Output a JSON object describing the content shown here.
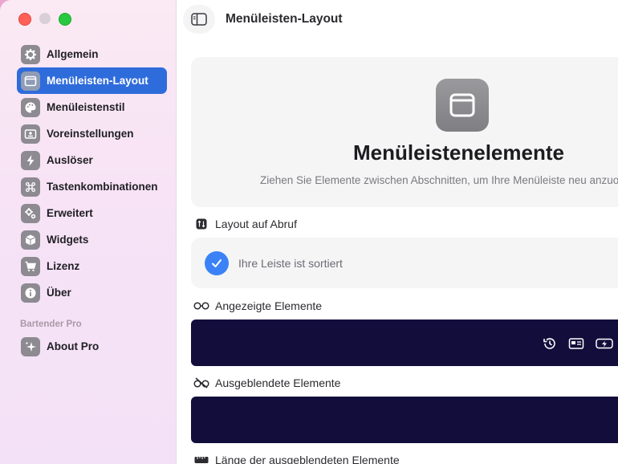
{
  "window": {
    "page_title": "Menüleisten-Layout"
  },
  "sidebar": {
    "items": [
      {
        "label": "Allgemein",
        "icon": "gear-icon",
        "active": false
      },
      {
        "label": "Menüleisten-Layout",
        "icon": "window-icon",
        "active": true
      },
      {
        "label": "Menüleistenstil",
        "icon": "palette-icon",
        "active": false
      },
      {
        "label": "Voreinstellungen",
        "icon": "preset-icon",
        "active": false
      },
      {
        "label": "Auslöser",
        "icon": "bolt-icon",
        "active": false
      },
      {
        "label": "Tastenkombinationen",
        "icon": "command-icon",
        "active": false
      },
      {
        "label": "Erweitert",
        "icon": "gears-icon",
        "active": false
      },
      {
        "label": "Widgets",
        "icon": "cube-icon",
        "active": false
      },
      {
        "label": "Lizenz",
        "icon": "cart-icon",
        "active": false
      },
      {
        "label": "Über",
        "icon": "info-icon",
        "active": false
      }
    ],
    "section_label": "Bartender Pro",
    "pro_items": [
      {
        "label": "About Pro",
        "icon": "sparkle-icon"
      }
    ]
  },
  "hero": {
    "icon": "menubar-window-icon",
    "title": "Menüleistenelemente",
    "subtitle": "Ziehen Sie Elemente zwischen Abschnitten, um Ihre Menüleiste neu anzuordnen"
  },
  "sections": {
    "layout_on_demand": {
      "label": "Layout auf Abruf",
      "icon": "sort-icon"
    },
    "sorted_status": "Ihre Leiste ist sortiert",
    "shown": {
      "label": "Angezeigte Elemente",
      "icon": "glasses-icon"
    },
    "hidden": {
      "label": "Ausgeblendete Elemente",
      "icon": "hidden-glasses-icon"
    },
    "hidden_length": {
      "label": "Länge der ausgeblendeten Elemente",
      "icon": "ruler-icon"
    }
  },
  "shown_bar_icons": [
    "history-icon",
    "id-card-icon",
    "battery-icon"
  ],
  "colors": {
    "accent": "#2f6cdb",
    "check": "#3b82f6",
    "bar": "#120d3a"
  }
}
